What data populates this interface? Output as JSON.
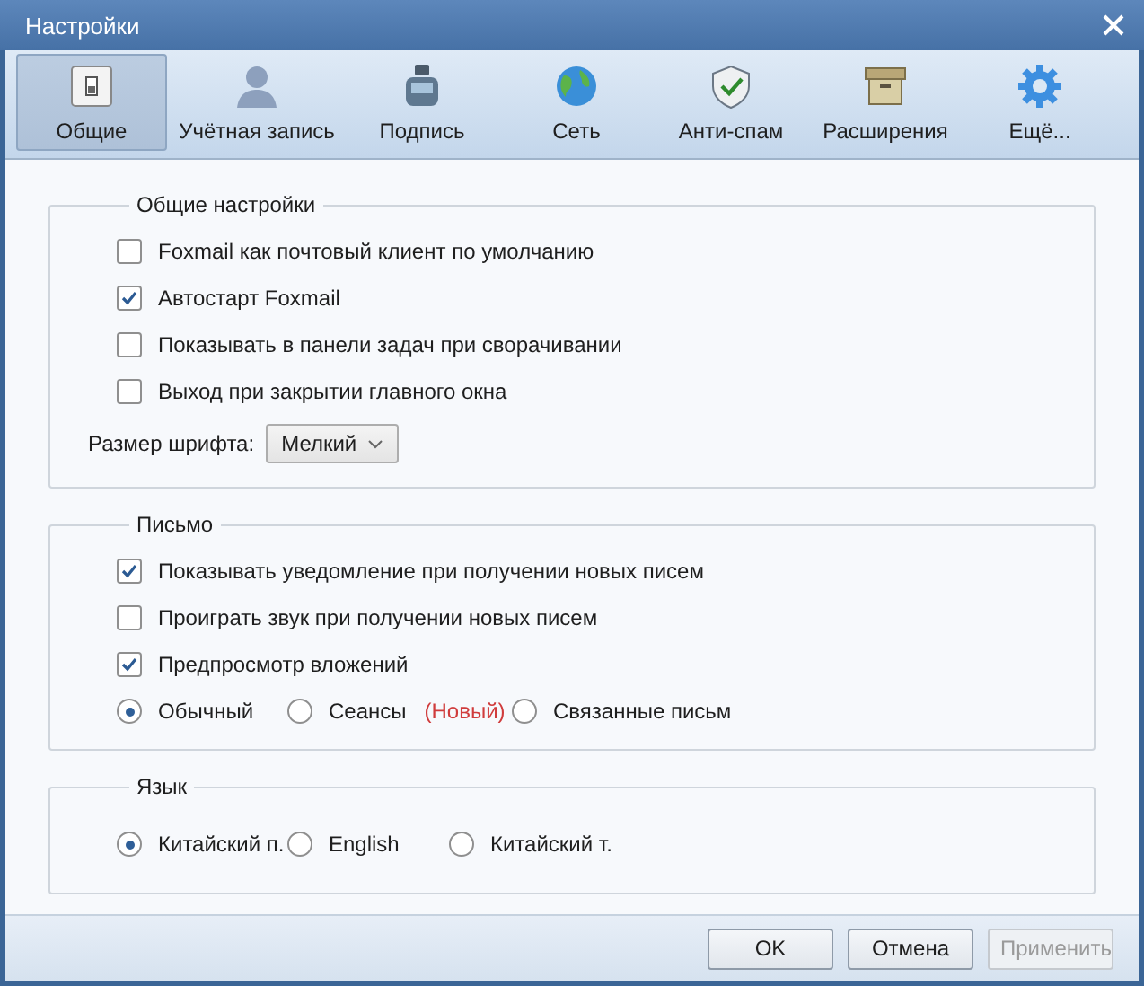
{
  "window": {
    "title": "Настройки"
  },
  "tabs": [
    {
      "label": "Общие",
      "selected": true
    },
    {
      "label": "Учётная запись",
      "selected": false
    },
    {
      "label": "Подпись",
      "selected": false
    },
    {
      "label": "Сеть",
      "selected": false
    },
    {
      "label": "Анти-спам",
      "selected": false
    },
    {
      "label": "Расширения",
      "selected": false
    },
    {
      "label": "Ещё...",
      "selected": false
    }
  ],
  "groups": [
    {
      "title": "Общие настройки",
      "rows": [
        {
          "kind": "checkbox",
          "label": "Foxmail как почтовый клиент по умолчанию",
          "checked": false
        },
        {
          "kind": "checkbox",
          "label": "Автостарт Foxmail",
          "checked": true
        },
        {
          "kind": "checkbox",
          "label": "Показывать в панели задач при сворачивании",
          "checked": false
        },
        {
          "kind": "checkbox",
          "label": "Выход при закрытии главного окна",
          "checked": false
        },
        {
          "kind": "dropdown",
          "label": "Размер шрифта:",
          "value": "Мелкий"
        }
      ]
    },
    {
      "title": "Письмо",
      "rows": [
        {
          "kind": "checkbox",
          "label": "Показывать уведомление при получении новых писем",
          "checked": true
        },
        {
          "kind": "checkbox",
          "label": "Проиграть звук при получении новых писем",
          "checked": false
        },
        {
          "kind": "checkbox",
          "label": "Предпросмотр вложений",
          "checked": true
        },
        {
          "kind": "radios",
          "options": [
            {
              "label": "Обычный",
              "selected": true
            },
            {
              "label": "Сеансы",
              "badge": "(Новый)",
              "selected": false
            },
            {
              "label": "Связанные письм",
              "selected": false
            }
          ]
        }
      ]
    },
    {
      "title": "Язык",
      "rows": [
        {
          "kind": "radios",
          "options": [
            {
              "label": "Китайский п.",
              "selected": true
            },
            {
              "label": "English",
              "selected": false
            },
            {
              "label": "Китайский т.",
              "selected": false
            }
          ]
        }
      ]
    }
  ],
  "buttons": [
    {
      "label": "OK",
      "disabled": false
    },
    {
      "label": "Отмена",
      "disabled": false
    },
    {
      "label": "Применить",
      "disabled": true
    }
  ]
}
